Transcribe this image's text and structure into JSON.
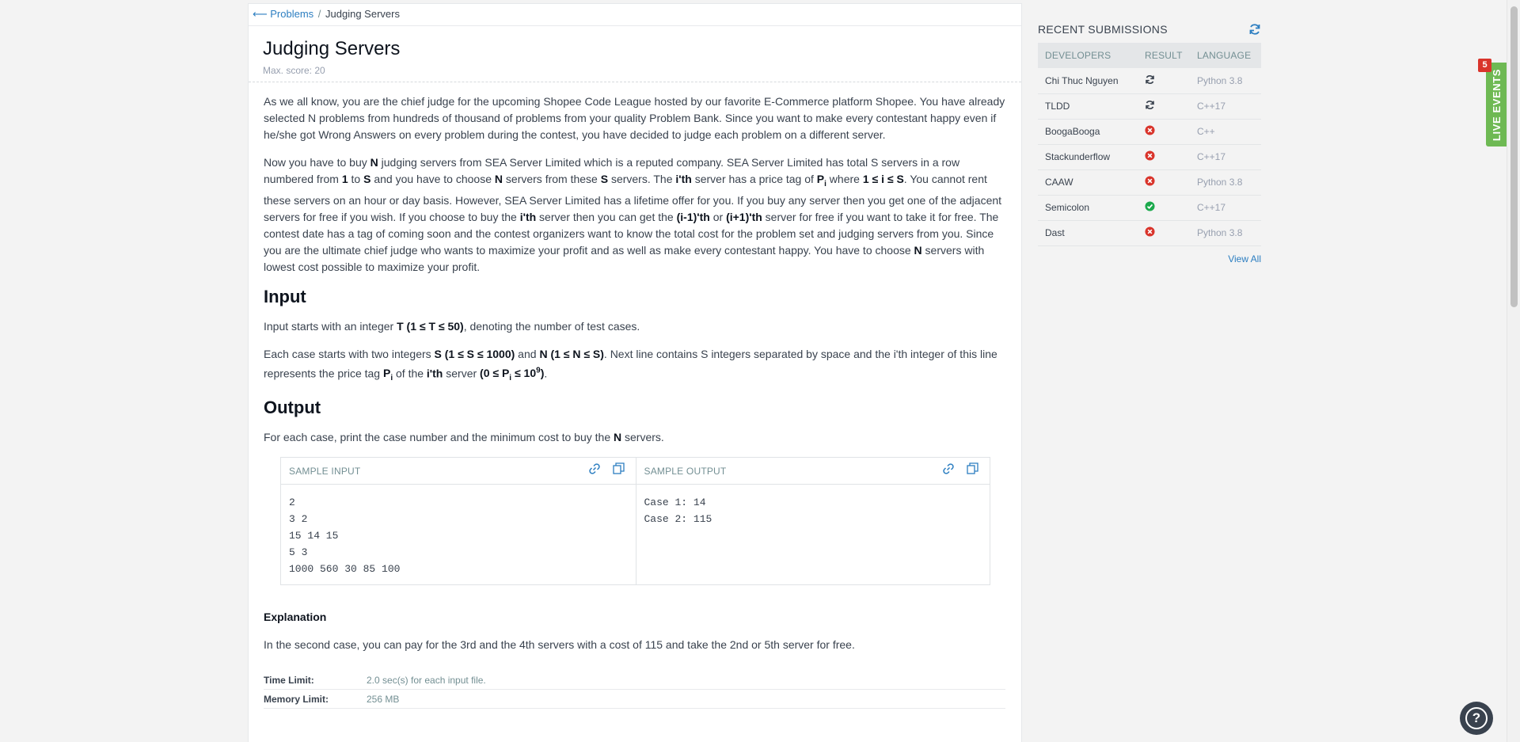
{
  "breadcrumb": {
    "back_label": "⟵ Problems",
    "separator": "/",
    "current": "Judging Servers"
  },
  "problem": {
    "title": "Judging Servers",
    "max_score": "Max. score: 20"
  },
  "statement": {
    "p1": "As we all know, you are the chief judge for the upcoming Shopee Code League hosted by our favorite E-Commerce platform Shopee. You have already selected N problems from hundreds of thousand of problems from your quality Problem Bank. Since you want to make every contestant happy even if he/she got Wrong Answers on every problem during the contest, you have decided to judge each problem on a different server.",
    "p2_a": "Now you have to buy ",
    "p2_b": "N",
    "p2_c": " judging servers from SEA Server Limited which is a reputed company. SEA Server Limited has total S servers in a row numbered from ",
    "p2_d": "1",
    "p2_e": " to ",
    "p2_f": "S",
    "p2_g": " and you have to choose ",
    "p2_h": "N",
    "p2_i": " servers from these ",
    "p2_j": "S",
    "p2_k": " servers. The ",
    "p2_l": "i'th",
    "p2_m": " server has a price tag of ",
    "p2_n": "P",
    "p2_n_sub": "i",
    "p2_o": " where ",
    "p2_p": "1 ≤ i ≤ S",
    "p2_q": ". You cannot rent these servers on an hour or day basis. However, SEA Server Limited has a lifetime offer for you. If you buy any server then you get one of the adjacent servers for free if you wish. If you choose to buy the ",
    "p2_r": "i'th",
    "p2_s": " server then you can get the ",
    "p2_t": "(i-1)'th",
    "p2_u": " or ",
    "p2_v": "(i+1)'th",
    "p2_w": " server for free if you want to take it for free. The contest date has a tag of coming soon and the contest organizers want to know the total cost for the problem set and judging servers from you. Since you are the ultimate chief judge who wants to maximize your profit and as well as make every contestant happy. You have to choose ",
    "p2_x": "N",
    "p2_y": " servers with lowest cost possible to maximize your profit."
  },
  "input_section": {
    "heading": "Input",
    "line1_a": "Input starts with an integer ",
    "line1_b": "T (1 ≤ T ≤ 50)",
    "line1_c": ", denoting the number of test cases.",
    "line2_a": "Each case starts with two integers ",
    "line2_b": "S (1 ≤ S ≤ 1000)",
    "line2_c": " and ",
    "line2_d": "N (1 ≤ N ≤ S)",
    "line2_e": ". Next line contains S integers separated by space and the i'th integer of this line represents the price tag ",
    "line2_f": "P",
    "line2_f_sub": "i",
    "line2_g": " of the ",
    "line2_h": "i'th",
    "line2_i": " server ",
    "line2_j": "(0 ≤ P",
    "line2_j_sub": "i",
    "line2_k": " ≤ 10",
    "line2_k_sup": "9",
    "line2_l": ")",
    "line2_m": "."
  },
  "output_section": {
    "heading": "Output",
    "line_a": "For each case, print the case number and the minimum cost to buy the ",
    "line_b": "N",
    "line_c": " servers."
  },
  "samples": {
    "input_label": "SAMPLE INPUT",
    "output_label": "SAMPLE OUTPUT",
    "input_text": "2\n3 2\n15 14 15\n5 3\n1000 560 30 85 100",
    "output_text": "Case 1: 14\nCase 2: 115"
  },
  "explanation": {
    "heading": "Explanation",
    "text": "In the second case, you can pay for the 3rd and the 4th servers with a cost of 115 and take the 2nd or 5th server for free."
  },
  "limits": [
    {
      "label": "Time Limit:",
      "value": "2.0 sec(s) for each input file."
    },
    {
      "label": "Memory Limit:",
      "value": "256 MB"
    }
  ],
  "recent_submissions": {
    "title": "RECENT SUBMISSIONS",
    "columns": [
      "DEVELOPERS",
      "RESULT",
      "LANGUAGE"
    ],
    "rows": [
      {
        "developer": "Chi Thuc Nguyen",
        "result": "pending",
        "language": "Python 3.8"
      },
      {
        "developer": "TLDD",
        "result": "pending",
        "language": "C++17"
      },
      {
        "developer": "BoogaBooga",
        "result": "wrong",
        "language": "C++"
      },
      {
        "developer": "Stackunderflow",
        "result": "wrong",
        "language": "C++17"
      },
      {
        "developer": "CAAW",
        "result": "wrong",
        "language": "Python 3.8"
      },
      {
        "developer": "Semicolon",
        "result": "accepted",
        "language": "C++17"
      },
      {
        "developer": "Dast",
        "result": "wrong",
        "language": "Python 3.8"
      }
    ],
    "view_all": "View All"
  },
  "live_events": {
    "label": "LIVE EVENTS",
    "badge": "5"
  },
  "help": {
    "label": "?"
  },
  "colors": {
    "link": "#2c7ec1",
    "accepted": "#1ba94c",
    "wrong": "#d9342b",
    "live_events": "#6eb953"
  }
}
